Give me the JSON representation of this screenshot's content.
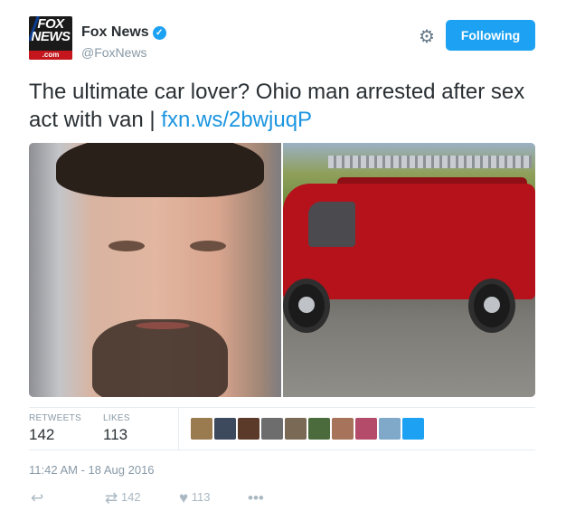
{
  "author": {
    "name": "Fox News",
    "handle": "@FoxNews",
    "avatar_text": "FOX NEWS",
    "avatar_sub": ".com",
    "verified": true
  },
  "follow_button": "Following",
  "tweet": {
    "text": "The ultimate car lover? Ohio man arrested after sex act with van | ",
    "link": "fxn.ws/2bwjuqP"
  },
  "stats": {
    "retweets_label": "RETWEETS",
    "retweets": "142",
    "likes_label": "LIKES",
    "likes": "113"
  },
  "likers": [
    {
      "icon": "liker-avatar",
      "color": "#9a7b4f"
    },
    {
      "icon": "liker-avatar",
      "color": "#3d4a5e"
    },
    {
      "icon": "liker-avatar",
      "color": "#5b3a2a"
    },
    {
      "icon": "liker-avatar",
      "color": "#6d6d6d"
    },
    {
      "icon": "liker-avatar",
      "color": "#7a6a55"
    },
    {
      "icon": "liker-avatar",
      "color": "#4c6b3c"
    },
    {
      "icon": "liker-avatar",
      "color": "#a7735b"
    },
    {
      "icon": "liker-avatar",
      "color": "#b44b6a"
    },
    {
      "icon": "liker-avatar",
      "color": "#7fa8c9"
    },
    {
      "icon": "liker-avatar",
      "color": "#1da1f2"
    }
  ],
  "timestamp": "11:42 AM - 18 Aug 2016",
  "actions": {
    "reply_icon": "reply-icon",
    "retweet_icon": "retweet-icon",
    "retweet_count": "142",
    "like_icon": "heart-icon",
    "like_count": "113",
    "more_icon": "more-icon"
  },
  "colors": {
    "accent": "#1da1f2",
    "link": "#1b95e0",
    "muted": "#8899a6",
    "text": "#292f33"
  }
}
